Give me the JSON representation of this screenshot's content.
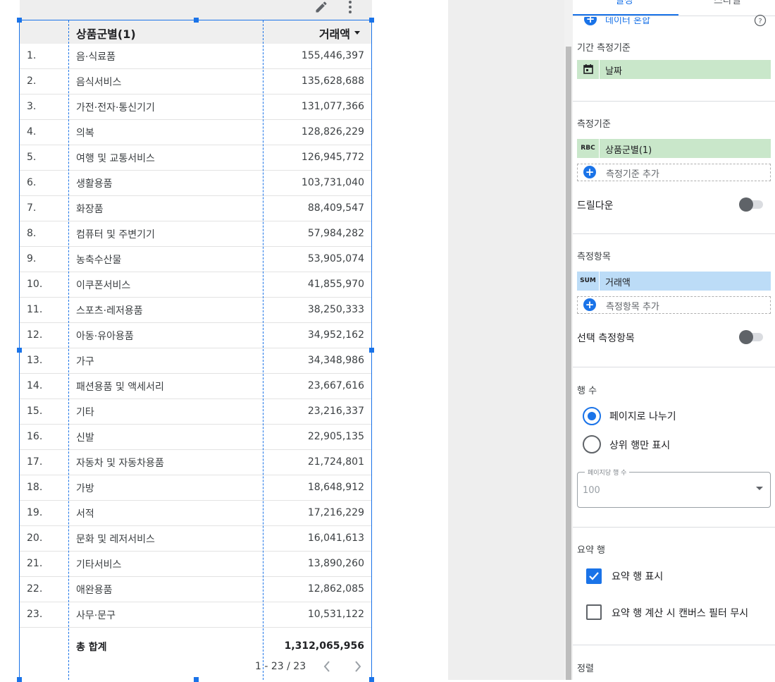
{
  "table": {
    "header": {
      "category_label": "상품군별(1)",
      "value_label": "거래액"
    },
    "rows": [
      {
        "index": "1.",
        "category": "음·식료품",
        "value": "155,446,397"
      },
      {
        "index": "2.",
        "category": "음식서비스",
        "value": "135,628,688"
      },
      {
        "index": "3.",
        "category": "가전·전자·통신기기",
        "value": "131,077,366"
      },
      {
        "index": "4.",
        "category": "의복",
        "value": "128,826,229"
      },
      {
        "index": "5.",
        "category": "여행 및 교통서비스",
        "value": "126,945,772"
      },
      {
        "index": "6.",
        "category": "생활용품",
        "value": "103,731,040"
      },
      {
        "index": "7.",
        "category": "화장품",
        "value": "88,409,547"
      },
      {
        "index": "8.",
        "category": "컴퓨터 및 주변기기",
        "value": "57,984,282"
      },
      {
        "index": "9.",
        "category": "농축수산물",
        "value": "53,905,074"
      },
      {
        "index": "10.",
        "category": "이쿠폰서비스",
        "value": "41,855,970"
      },
      {
        "index": "11.",
        "category": "스포츠·레저용품",
        "value": "38,250,333"
      },
      {
        "index": "12.",
        "category": "아동·유아용품",
        "value": "34,952,162"
      },
      {
        "index": "13.",
        "category": "가구",
        "value": "34,348,986"
      },
      {
        "index": "14.",
        "category": "패션용품 및 액세서리",
        "value": "23,667,616"
      },
      {
        "index": "15.",
        "category": "기타",
        "value": "23,216,337"
      },
      {
        "index": "16.",
        "category": "신발",
        "value": "22,905,135"
      },
      {
        "index": "17.",
        "category": "자동차 및 자동차용품",
        "value": "21,724,801"
      },
      {
        "index": "18.",
        "category": "가방",
        "value": "18,648,912"
      },
      {
        "index": "19.",
        "category": "서적",
        "value": "17,216,229"
      },
      {
        "index": "20.",
        "category": "문화 및 레저서비스",
        "value": "16,041,613"
      },
      {
        "index": "21.",
        "category": "기타서비스",
        "value": "13,890,260"
      },
      {
        "index": "22.",
        "category": "애완용품",
        "value": "12,862,085"
      },
      {
        "index": "23.",
        "category": "사무·문구",
        "value": "10,531,122"
      }
    ],
    "total": {
      "label": "총 합계",
      "value": "1,312,065,956"
    },
    "pagination": {
      "range": "1 - 23 / 23"
    }
  },
  "panel": {
    "tabs": {
      "setup": "설정",
      "style": "스타일"
    },
    "data_blend_label": "데이터 혼합",
    "date_range_dimension": {
      "title": "기간 측정기준",
      "chip": "날짜"
    },
    "dimension": {
      "title": "측정기준",
      "chip_type": "RBC",
      "chip": "상품군별(1)",
      "add_label": "측정기준 추가",
      "drilldown_label": "드릴다운"
    },
    "metric": {
      "title": "측정항목",
      "chip_type": "SUM",
      "chip": "거래액",
      "add_label": "측정항목 추가",
      "optional_label": "선택 측정항목"
    },
    "rows_count": {
      "title": "행 수",
      "options": [
        "페이지로 나누기",
        "상위 행만 표시"
      ],
      "selected": "페이지로 나누기",
      "field_label": "페이지당 행 수",
      "field_value": "100"
    },
    "summary_row": {
      "title": "요약 행",
      "show_label": "요약 행 표시",
      "show_checked": true,
      "ignore_filter_label": "요약 행 계산 시 캔버스 필터 무시",
      "ignore_filter_checked": false
    },
    "sort": {
      "title": "정렬"
    }
  },
  "colors": {
    "accent": "#1a73e8",
    "dimension_chip": "#c9e7ca",
    "metric_chip": "#bcdcf7"
  }
}
